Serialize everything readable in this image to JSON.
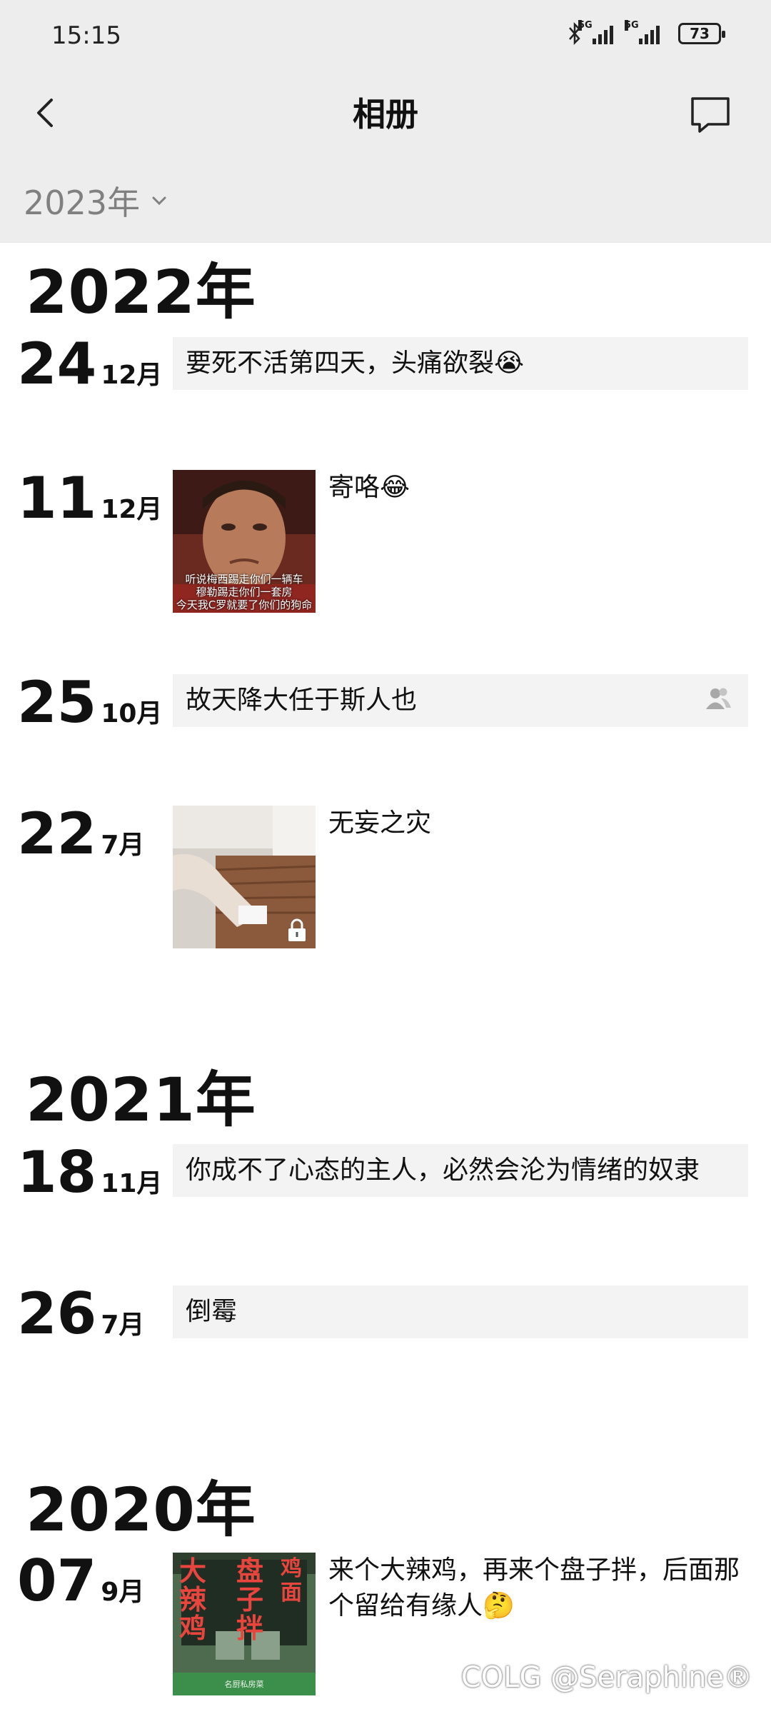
{
  "status_bar": {
    "time": "15:15",
    "signal_tag_1": "5G",
    "signal_tag_2": "5G",
    "battery": "73"
  },
  "nav": {
    "title": "相册"
  },
  "filter": {
    "year_label": "2023年"
  },
  "years": [
    "2022年",
    "2021年",
    "2020年"
  ],
  "posts": [
    {
      "day": "24",
      "month": "12月",
      "text": "要死不活第四天，头痛欲裂😭"
    },
    {
      "day": "11",
      "month": "12月",
      "text": "寄咯😂",
      "image_caption": "听说梅西踢走你们一辆车\n穆勒踢走你们一套房\n今天我C罗就要了你们的狗命"
    },
    {
      "day": "25",
      "month": "10月",
      "text": "故天降大任于斯人也"
    },
    {
      "day": "22",
      "month": "7月",
      "text": "无妄之灾"
    },
    {
      "day": "18",
      "month": "11月",
      "text": "你成不了心态的主人，必然会沦为情绪的奴隶"
    },
    {
      "day": "26",
      "month": "7月",
      "text": "倒霉"
    },
    {
      "day": "07",
      "month": "9月",
      "text": "来个大辣鸡，再来个盘子拌，后面那个留给有缘人🤔",
      "image_sign_left": "大辣鸡",
      "image_sign_mid": "盘子拌",
      "image_sign_right": "鸡面"
    }
  ],
  "watermark": "COLG @Seraphine®",
  "colors": {
    "bar_bg": "#ededed",
    "card_bg": "#f3f3f3",
    "muted": "#808080"
  }
}
